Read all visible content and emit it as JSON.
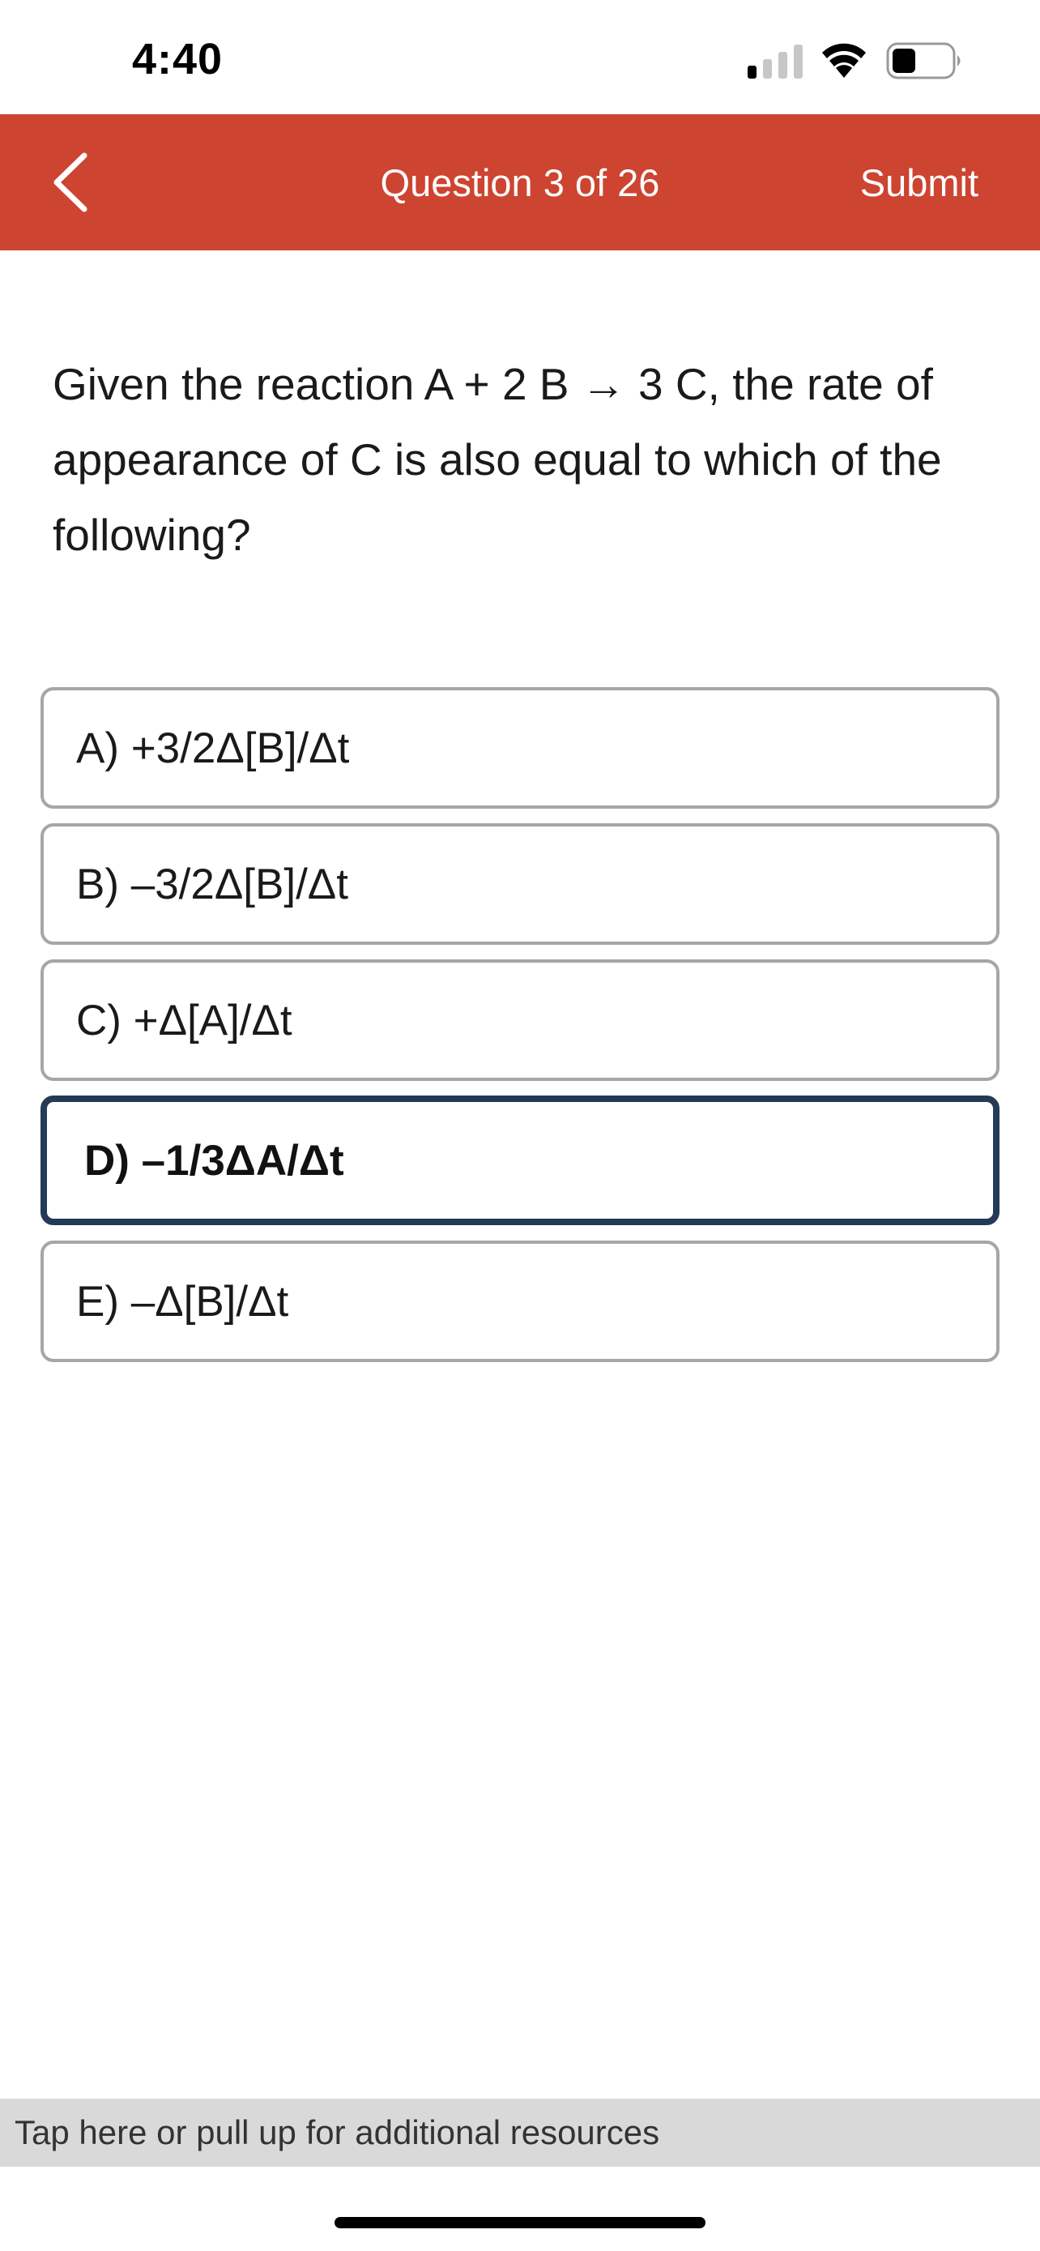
{
  "status_bar": {
    "time": "4:40"
  },
  "header": {
    "title": "Question 3 of 26",
    "submit_label": "Submit",
    "background_color": "#cd4431"
  },
  "question": {
    "text": "Given the reaction A + 2 B → 3 C, the rate of appearance of C is also equal to which of the following?"
  },
  "options": [
    {
      "label": "A) +3/2Δ[B]/Δt",
      "selected": false
    },
    {
      "label": "B) –3/2Δ[B]/Δt",
      "selected": false
    },
    {
      "label": "C) +Δ[A]/Δt",
      "selected": false
    },
    {
      "label": "D) –1/3ΔA/Δt",
      "selected": true
    },
    {
      "label": "E) –Δ[B]/Δt",
      "selected": false
    }
  ],
  "resources": {
    "label": "Tap here or pull up for additional resources"
  },
  "colors": {
    "selected_border": "#243a55",
    "option_border": "#a6a6a6"
  }
}
